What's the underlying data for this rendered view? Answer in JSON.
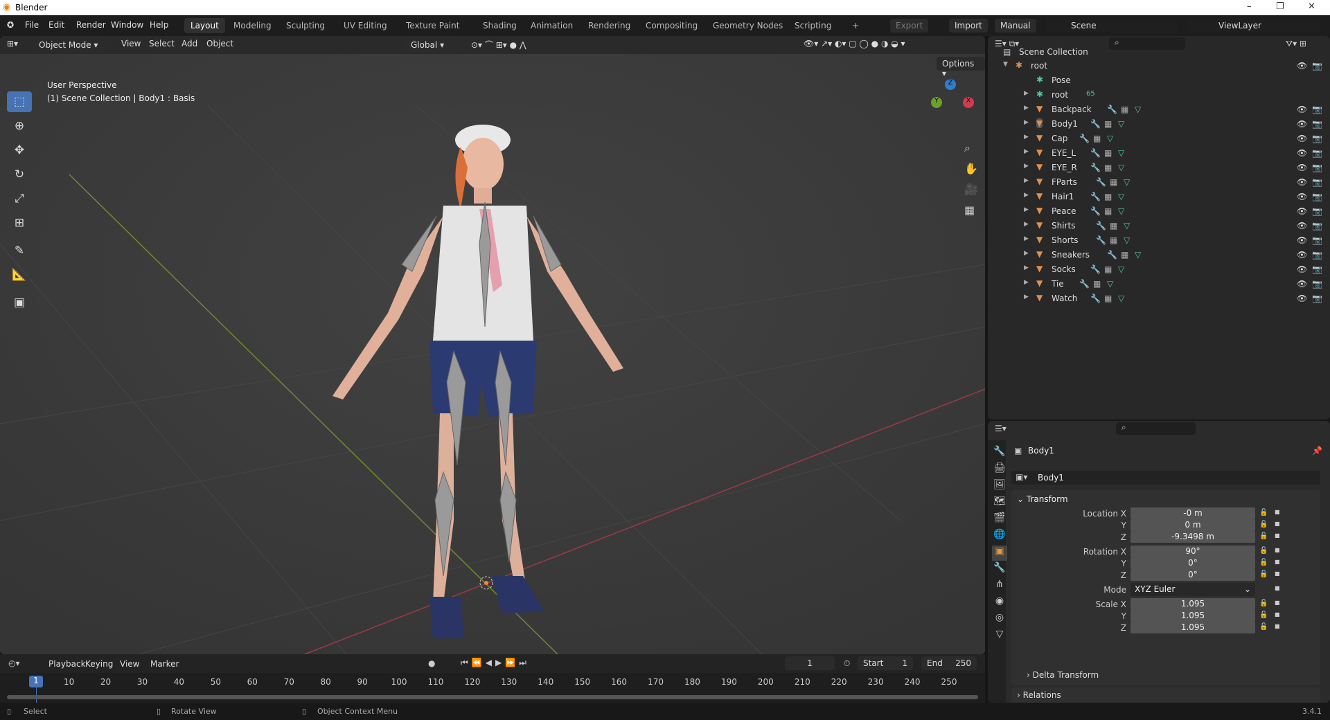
{
  "window": {
    "title": "Blender",
    "minimize": "–",
    "restore": "❐",
    "close": "✕"
  },
  "menus": [
    "File",
    "Edit",
    "Render",
    "Window",
    "Help"
  ],
  "workspaces": [
    "Layout",
    "Modeling",
    "Sculpting",
    "UV Editing",
    "Texture Paint",
    "Shading",
    "Animation",
    "Rendering",
    "Compositing",
    "Geometry Nodes",
    "Scripting",
    "+"
  ],
  "topright": {
    "export": "Export",
    "import": "Import",
    "manual": "Manual",
    "scene": "Scene",
    "viewlayer": "ViewLayer"
  },
  "viewport": {
    "mode": "Object Mode",
    "menus": [
      "View",
      "Select",
      "Add",
      "Object"
    ],
    "orientation": "Global",
    "options": "Options",
    "perspective": "User Perspective",
    "context": "(1) Scene Collection | Body1 : Basis",
    "gizmo": {
      "x": "X",
      "y": "Y",
      "z": "Z"
    }
  },
  "tools": [
    "select-box",
    "cursor",
    "move",
    "rotate",
    "scale",
    "transform",
    "annotate",
    "measure",
    "add-cube"
  ],
  "outliner": {
    "root_label": "Scene Collection",
    "items": [
      {
        "name": "root",
        "type": "armature",
        "level": 0,
        "vis": true
      },
      {
        "name": "Pose",
        "type": "pose",
        "level": 1,
        "vis": false
      },
      {
        "name": "root",
        "type": "armature-data",
        "level": 1,
        "vis": false,
        "badge": "65"
      },
      {
        "name": "Backpack",
        "type": "mesh",
        "level": 1,
        "vis": true
      },
      {
        "name": "Body1",
        "type": "mesh",
        "level": 1,
        "vis": true,
        "selected": true
      },
      {
        "name": "Cap",
        "type": "mesh",
        "level": 1,
        "vis": true
      },
      {
        "name": "EYE_L",
        "type": "mesh",
        "level": 1,
        "vis": true
      },
      {
        "name": "EYE_R",
        "type": "mesh",
        "level": 1,
        "vis": true
      },
      {
        "name": "FParts",
        "type": "mesh",
        "level": 1,
        "vis": true
      },
      {
        "name": "Hair1",
        "type": "mesh",
        "level": 1,
        "vis": true
      },
      {
        "name": "Peace",
        "type": "mesh",
        "level": 1,
        "vis": true
      },
      {
        "name": "Shirts",
        "type": "mesh",
        "level": 1,
        "vis": true
      },
      {
        "name": "Shorts",
        "type": "mesh",
        "level": 1,
        "vis": true
      },
      {
        "name": "Sneakers",
        "type": "mesh",
        "level": 1,
        "vis": true
      },
      {
        "name": "Socks",
        "type": "mesh",
        "level": 1,
        "vis": true
      },
      {
        "name": "Tie",
        "type": "mesh",
        "level": 1,
        "vis": true
      },
      {
        "name": "Watch",
        "type": "mesh",
        "level": 1,
        "vis": true
      }
    ]
  },
  "properties": {
    "object_name": "Body1",
    "datablock": "Body1",
    "panel": "Transform",
    "rows": [
      {
        "label": "Location X",
        "value": "-0 m"
      },
      {
        "label": "Y",
        "value": "0 m"
      },
      {
        "label": "Z",
        "value": "-9.3498 m"
      },
      {
        "label": "Rotation X",
        "value": "90°"
      },
      {
        "label": "Y",
        "value": "0°"
      },
      {
        "label": "Z",
        "value": "0°"
      },
      {
        "label": "Mode",
        "value": "XYZ Euler",
        "dropdown": true
      },
      {
        "label": "Scale X",
        "value": "1.095"
      },
      {
        "label": "Y",
        "value": "1.095"
      },
      {
        "label": "Z",
        "value": "1.095"
      }
    ],
    "delta": "Delta Transform",
    "relations": "Relations"
  },
  "timeline": {
    "menus": [
      "Playback",
      "Keying",
      "View",
      "Marker"
    ],
    "current_frame": "1",
    "start_label": "Start",
    "start": "1",
    "end_label": "End",
    "end": "250",
    "ticks": [
      "10",
      "20",
      "30",
      "40",
      "50",
      "60",
      "70",
      "80",
      "90",
      "100",
      "110",
      "120",
      "130",
      "140",
      "150",
      "160",
      "170",
      "180",
      "190",
      "200",
      "210",
      "220",
      "230",
      "240",
      "250"
    ]
  },
  "status": {
    "select": "Select",
    "rotate": "Rotate View",
    "context": "Object Context Menu",
    "version": "3.4.1"
  }
}
